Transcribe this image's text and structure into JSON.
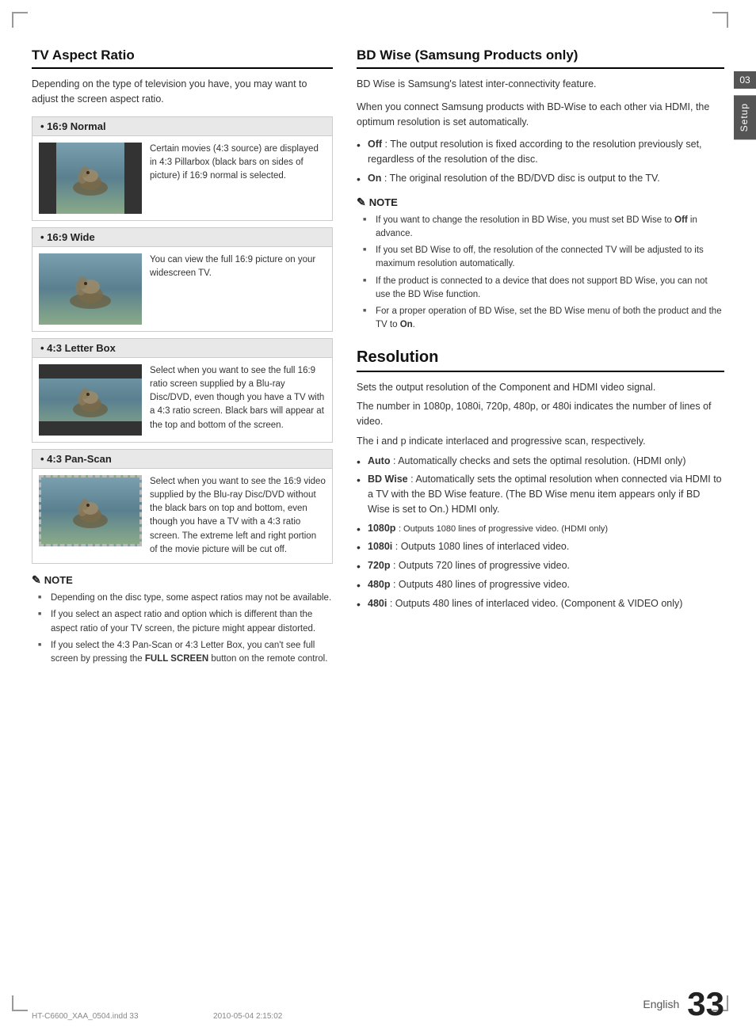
{
  "page": {
    "number": "33",
    "language": "English",
    "footer_left": "HT-C6600_XAA_0504.indd   33",
    "footer_right": "2010-05-04   2:15:02",
    "chapter_number": "03",
    "chapter_label": "Setup"
  },
  "left_column": {
    "section_title": "TV Aspect Ratio",
    "section_intro": "Depending on the type of television you have, you may want to adjust the screen aspect ratio.",
    "aspect_items": [
      {
        "id": "169normal",
        "header": "• 16:9 Normal",
        "image_type": "pillarbox",
        "description": "Certain movies (4:3 source) are displayed in 4:3 Pillarbox (black bars on sides of picture) if 16:9 normal is selected."
      },
      {
        "id": "169wide",
        "header": "• 16:9 Wide",
        "image_type": "normal",
        "description": "You can view the full 16:9 picture on your widescreen TV."
      },
      {
        "id": "43letterbox",
        "header": "• 4:3 Letter Box",
        "image_type": "letterbox",
        "description": "Select when you want to see the full 16:9 ratio screen supplied by a Blu-ray Disc/DVD, even though you have a TV with a 4:3 ratio screen. Black bars will appear at the top and bottom of the screen."
      },
      {
        "id": "43panscan",
        "header": "• 4:3 Pan-Scan",
        "image_type": "panscan",
        "description": "Select when you want to see the 16:9 video supplied by the Blu-ray Disc/DVD without the black bars on top and bottom, even though you have a TV with a 4:3 ratio screen. The extreme left and right portion of the movie picture will be cut off."
      }
    ],
    "note_title": "NOTE",
    "note_items": [
      "Depending on the disc type, some aspect ratios may not be available.",
      "If you select an aspect ratio and option which is different than the aspect ratio of your TV screen, the picture might appear distorted.",
      "If you select the 4:3 Pan-Scan or 4:3 Letter Box, you can't see full screen by pressing the FULL SCREEN button on the remote control."
    ],
    "note_bold_parts": [
      "FULL SCREEN"
    ]
  },
  "right_column": {
    "bd_wise_title": "BD Wise (Samsung Products only)",
    "bd_wise_intro": "BD Wise is Samsung's latest inter-connectivity feature.",
    "bd_wise_body": "When you connect Samsung products with BD-Wise to each other via HDMI, the optimum resolution is set automatically.",
    "bd_wise_bullets": [
      {
        "bold": "Off",
        "text": ": The output resolution is fixed according to the resolution previously set, regardless of the resolution of the disc."
      },
      {
        "bold": "On",
        "text": ": The original resolution of the BD/DVD disc is output to the TV."
      }
    ],
    "bd_wise_note_title": "NOTE",
    "bd_wise_note_items": [
      "If you want to change the resolution in BD Wise, you must set BD Wise to Off in advance.",
      "If you set BD Wise to off, the resolution of the connected TV will be adjusted to its maximum resolution automatically.",
      "If the product is connected to a device that does not support BD Wise, you can not use the BD Wise function.",
      "For a proper operation of BD Wise, set the BD Wise menu of both the product and the TV to On."
    ],
    "resolution_title": "Resolution",
    "resolution_desc1": "Sets the output resolution of the Component and HDMI video signal.",
    "resolution_desc2": "The number in 1080p, 1080i, 720p, 480p, or 480i indicates the number of lines of video.",
    "resolution_desc3": "The i and p indicate interlaced and progressive scan, respectively.",
    "resolution_bullets": [
      {
        "bold": "Auto",
        "text": ": Automatically checks and sets the optimal resolution. (HDMI only)"
      },
      {
        "bold": "BD Wise",
        "text": ": Automatically sets the optimal resolution when connected via HDMI to a TV with the BD Wise feature. (The BD Wise menu item appears only if BD Wise is set to On.) HDMI only."
      },
      {
        "bold": "1080p",
        "text": ": Outputs 1080 lines of progressive video. (HDMI only)",
        "small": true
      },
      {
        "bold": "1080i",
        "text": ": Outputs 1080 lines of interlaced video."
      },
      {
        "bold": "720p",
        "text": ": Outputs 720 lines of progressive video."
      },
      {
        "bold": "480p",
        "text": ": Outputs 480 lines of progressive video."
      },
      {
        "bold": "480i",
        "text": ": Outputs 480 lines of interlaced video. (Component & VIDEO only)"
      }
    ]
  }
}
